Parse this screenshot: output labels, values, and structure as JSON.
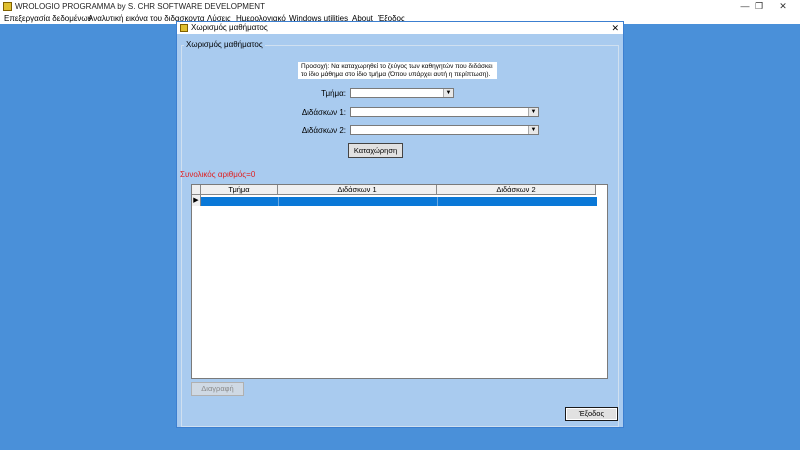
{
  "window": {
    "title": "WROLOGIO PROGRAMMA by S. CHR SOFTWARE DEVELOPMENT",
    "minimize": "—",
    "restore": "❐",
    "close": "✕"
  },
  "menu": {
    "items": [
      "Επεξεργασία δεδομένων",
      "Αναλυτική εικόνα του διδασκοντα",
      "Λύσεις",
      "Ημερολογιακό",
      "Windows utilities",
      "About",
      "Έξοδος"
    ]
  },
  "dialog": {
    "title": "Χωρισμός μαθήματος",
    "close": "✕",
    "group_label": "Χωρισμός μαθήματος",
    "warning_line1": "Προσοχή: Να καταχωρηθεί το ζεύγος των καθηγητών που διδάσκει",
    "warning_line2": "το ίδιο μάθημα στο ίδιο τμήμα (Όπου υπάρχει αυτή η περίπτωση).",
    "tmima_label": "Τμήμα:",
    "didaskon1_label": "Διδάσκων 1:",
    "didaskon2_label": "Διδάσκων 2:",
    "tmima_value": "",
    "didaskon1_value": "",
    "didaskon2_value": "",
    "dropdown_arrow": "▼",
    "save_button": "Καταχώρηση",
    "total": "Συνολικός αριθμός=0",
    "grid": {
      "columns": [
        "Τμήμα",
        "Διδάσκων 1",
        "Διδάσκων 2"
      ],
      "row_indicator": "▶",
      "rows": [
        [
          "",
          "",
          ""
        ]
      ]
    },
    "delete_button": "Διαγραφή",
    "exit_button": "Έξοδος"
  }
}
